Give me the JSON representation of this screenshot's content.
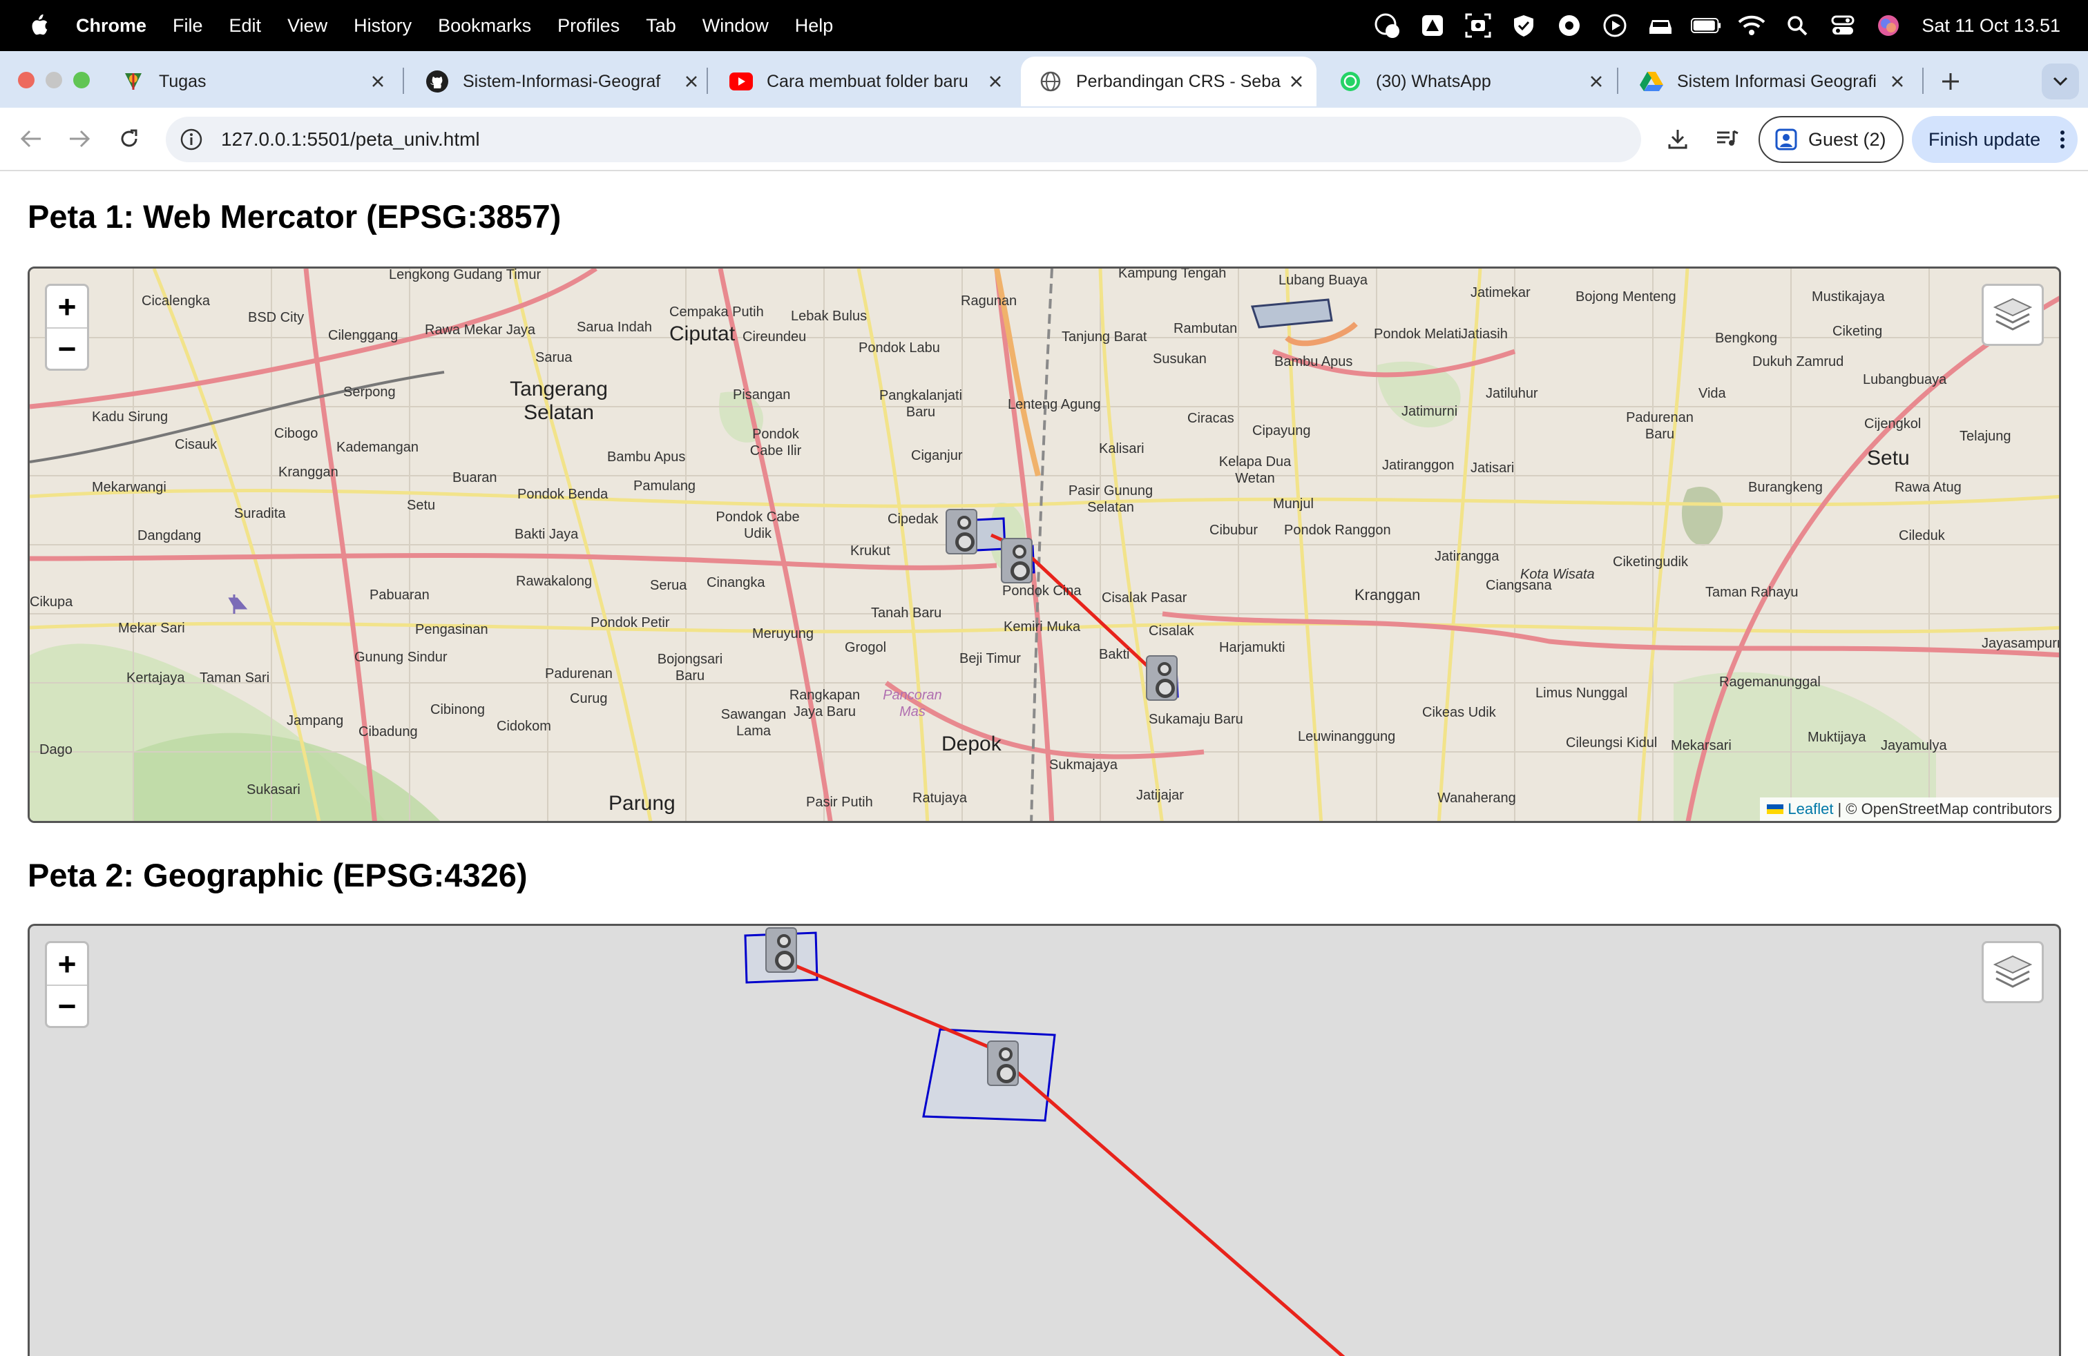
{
  "menubar": {
    "app": "Chrome",
    "items": [
      "File",
      "Edit",
      "View",
      "History",
      "Bookmarks",
      "Profiles",
      "Tab",
      "Window",
      "Help"
    ],
    "clock": "Sat 11 Oct  13.51"
  },
  "tabs": [
    {
      "title": "Tugas",
      "icon": "app-favicon-icon",
      "active": false
    },
    {
      "title": "Sistem-Informasi-Geograf",
      "icon": "github-icon",
      "active": false
    },
    {
      "title": "Cara membuat folder baru",
      "icon": "youtube-icon",
      "active": false
    },
    {
      "title": "Perbandingan CRS - Seba",
      "icon": "globe-icon",
      "active": true
    },
    {
      "title": "(30) WhatsApp",
      "icon": "whatsapp-icon",
      "active": false
    },
    {
      "title": "Sistem Informasi Geografi",
      "icon": "google-drive-icon",
      "active": false
    }
  ],
  "toolbar": {
    "url": "127.0.0.1:5501/peta_univ.html",
    "guest_label": "Guest (2)",
    "finish_label": "Finish update"
  },
  "maps": [
    {
      "heading": "Peta 1: Web Mercator (EPSG:3857)",
      "zoom_in": "+",
      "zoom_out": "−",
      "attribution_link": "Leaflet",
      "attribution_text": "| © OpenStreetMap contributors",
      "place_labels": [
        "Lengkong Gudang Timur",
        "Cicalengka",
        "BSD City",
        "Cilenggang",
        "Rawa Mekar Jaya",
        "Sarua Indah",
        "Sarua",
        "Cempaka Putih",
        "Ciputat",
        "Cireundeu",
        "Lebak Bulus",
        "Pondok Labu",
        "Ragunan",
        "Tanjung Barat",
        "Rambutan",
        "Susukan",
        "Kampung Tengah",
        "Lubang Buaya",
        "Bambu Apus",
        "Pondok Melati",
        "Jatiasih",
        "Jatimekar",
        "Bojong Menteng",
        "Mustikajaya",
        "Bengkong",
        "Ciketing",
        "Dukuh Zamrud",
        "Lubangbuaya",
        "Kadu Sirung",
        "Serpong",
        "Tangerang Selatan",
        "Pisangan",
        "Pangkalanjati Baru",
        "Lenteng Agung",
        "Ciracas",
        "Jatimurni",
        "Jatiluhur",
        "Vida",
        "Padurenan Baru",
        "Cijengkol",
        "Telajung",
        "Setu",
        "Cisauk",
        "Cibogo",
        "Kademangan",
        "Pondok Cabe Ilir",
        "Ciganjur",
        "Kalisari",
        "Cipayung",
        "Kelapa Dua Wetan",
        "Jatiranggon",
        "Jatisari",
        "Burangkeng",
        "Rawa Atug",
        "Mekarwangi",
        "Kranggan",
        "Buaran",
        "Bambu Apus",
        "Pamulang",
        "Pondok Benda",
        "Pasir Gunung Selatan",
        "Munjul",
        "Cileduk",
        "Suradita",
        "Setu",
        "Dangdang",
        "Bakti Jaya",
        "Pondok Cabe Udik",
        "Cipedak",
        "Krukut",
        "Cibubur",
        "Pondok Ranggon",
        "Jatirangga",
        "Ciangsana",
        "Kota Wisata",
        "Ciketingudik",
        "Rawakalong",
        "Serua",
        "Cinangka",
        "Pondok Cina",
        "Cisalak Pasar",
        "Kranggan",
        "Taman Rahayu",
        "Pabuaran",
        "Tanah Baru",
        "Kemiri Muka",
        "Cisalak",
        "Harjamukti",
        "Mekar Sari",
        "Pengasinan",
        "Pondok Petir",
        "Meruyung",
        "Grogol",
        "Beji Timur",
        "Bakti",
        "Jayasampurna",
        "Kertajaya",
        "Taman Sari",
        "Gunung Sindur",
        "Bojongsari Baru",
        "Padurenan",
        "Curug",
        "Limus Nunggal",
        "Ragemanunggal",
        "Jampang",
        "Cibinong",
        "Cibadung",
        "Cidokom",
        "Sawangan Lama",
        "Rangkapan Jaya Baru",
        "Pancoran Mas",
        "Depok",
        "Sukamaju Baru",
        "Cikeas Udik",
        "Leuwinanggung",
        "Cileungsi Kidul",
        "Mekarsari",
        "Muktijaya",
        "Jayamulya",
        "Dago",
        "Sukasari",
        "Parung",
        "Pasir Putih",
        "Ratujaya",
        "Sukmajaya",
        "Jatijajar",
        "Wanaherang",
        "Cikupa",
        "Pasir Putih"
      ]
    },
    {
      "heading": "Peta 2: Geographic (EPSG:4326)",
      "zoom_in": "+",
      "zoom_out": "−"
    }
  ],
  "colors": {
    "route_line": "#e8231b",
    "polygon_stroke": "#0000cc",
    "map2_background": "#dddddd"
  }
}
